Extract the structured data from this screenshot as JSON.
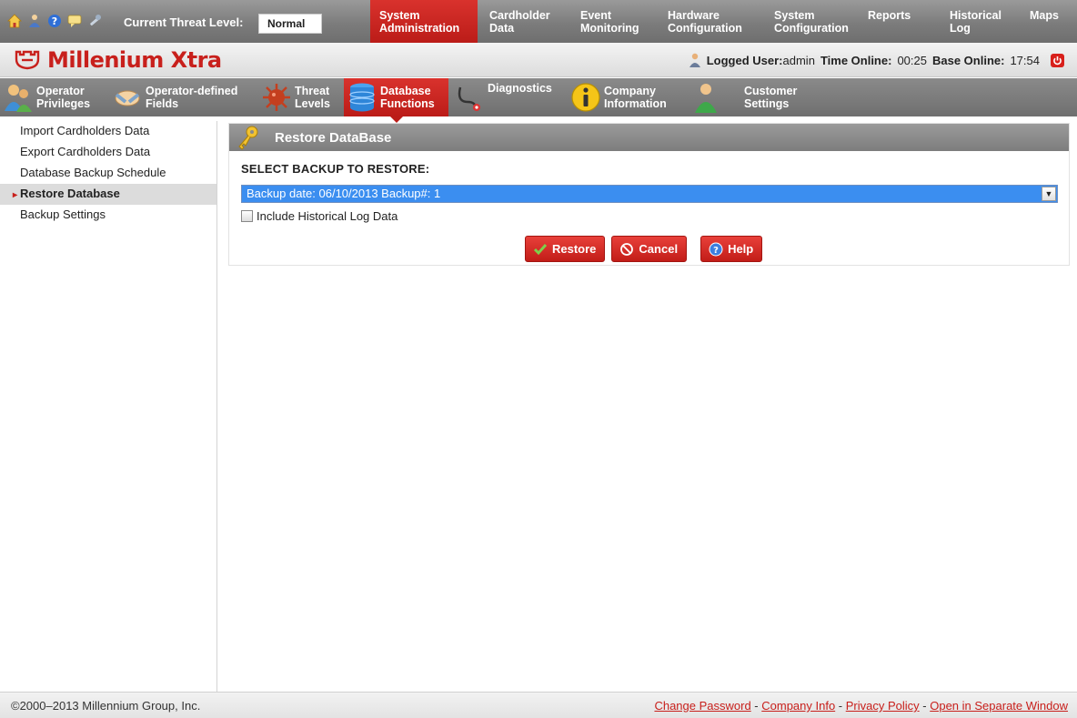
{
  "topbar": {
    "threat_label": "Current Threat Level:",
    "threat_value": "Normal",
    "quick_icons": [
      "home-icon",
      "users-icon",
      "help-icon",
      "chat-icon",
      "tools-icon"
    ],
    "nav": [
      {
        "line1": "System",
        "line2": "Administration",
        "active": true
      },
      {
        "line1": "Cardholder",
        "line2": "Data"
      },
      {
        "line1": "Event",
        "line2": "Monitoring"
      },
      {
        "line1": "Hardware",
        "line2": "Configuration"
      },
      {
        "line1": "System",
        "line2": "Configuration"
      },
      {
        "line1": "Reports",
        "line2": ""
      },
      {
        "line1": "Historical",
        "line2": "Log"
      },
      {
        "line1": "Maps",
        "line2": ""
      }
    ]
  },
  "brand": {
    "logo": "Millenium Xtra",
    "logged_label": "Logged User:",
    "logged_user": "admin",
    "time_online_label": "Time Online:",
    "time_online": "00:25",
    "base_online_label": "Base Online:",
    "base_online": "17:54"
  },
  "subnav": [
    {
      "line1": "Operator",
      "line2": "Privileges"
    },
    {
      "line1": "Operator-defined",
      "line2": "Fields"
    },
    {
      "line1": "Threat",
      "line2": "Levels"
    },
    {
      "line1": "Database",
      "line2": "Functions",
      "active": true
    },
    {
      "line1": "Diagnostics",
      "line2": ""
    },
    {
      "line1": "Company",
      "line2": "Information"
    },
    {
      "line1": "Customer",
      "line2": "Settings"
    }
  ],
  "sidebar": {
    "items": [
      {
        "label": "Import Cardholders Data"
      },
      {
        "label": "Export Cardholders Data"
      },
      {
        "label": "Database Backup Schedule"
      },
      {
        "label": "Restore Database",
        "active": true
      },
      {
        "label": "Backup Settings"
      }
    ]
  },
  "panel": {
    "title": "Restore DataBase",
    "select_label": "SELECT BACKUP TO RESTORE:",
    "selected_backup": "Backup date: 06/10/2013 Backup#: 1",
    "checkbox_label": "Include Historical Log Data",
    "checkbox_checked": false,
    "buttons": {
      "restore": "Restore",
      "cancel": "Cancel",
      "help": "Help"
    }
  },
  "footer": {
    "copyright": "©2000–2013 Millennium Group, Inc.",
    "links": [
      "Change Password",
      "Company Info",
      "Privacy Policy",
      "Open in Separate Window"
    ],
    "separator": " - "
  },
  "colors": {
    "accent_red": "#c8201c",
    "bar_gray": "#7c7c7c",
    "selection_blue": "#3b8ef0"
  }
}
